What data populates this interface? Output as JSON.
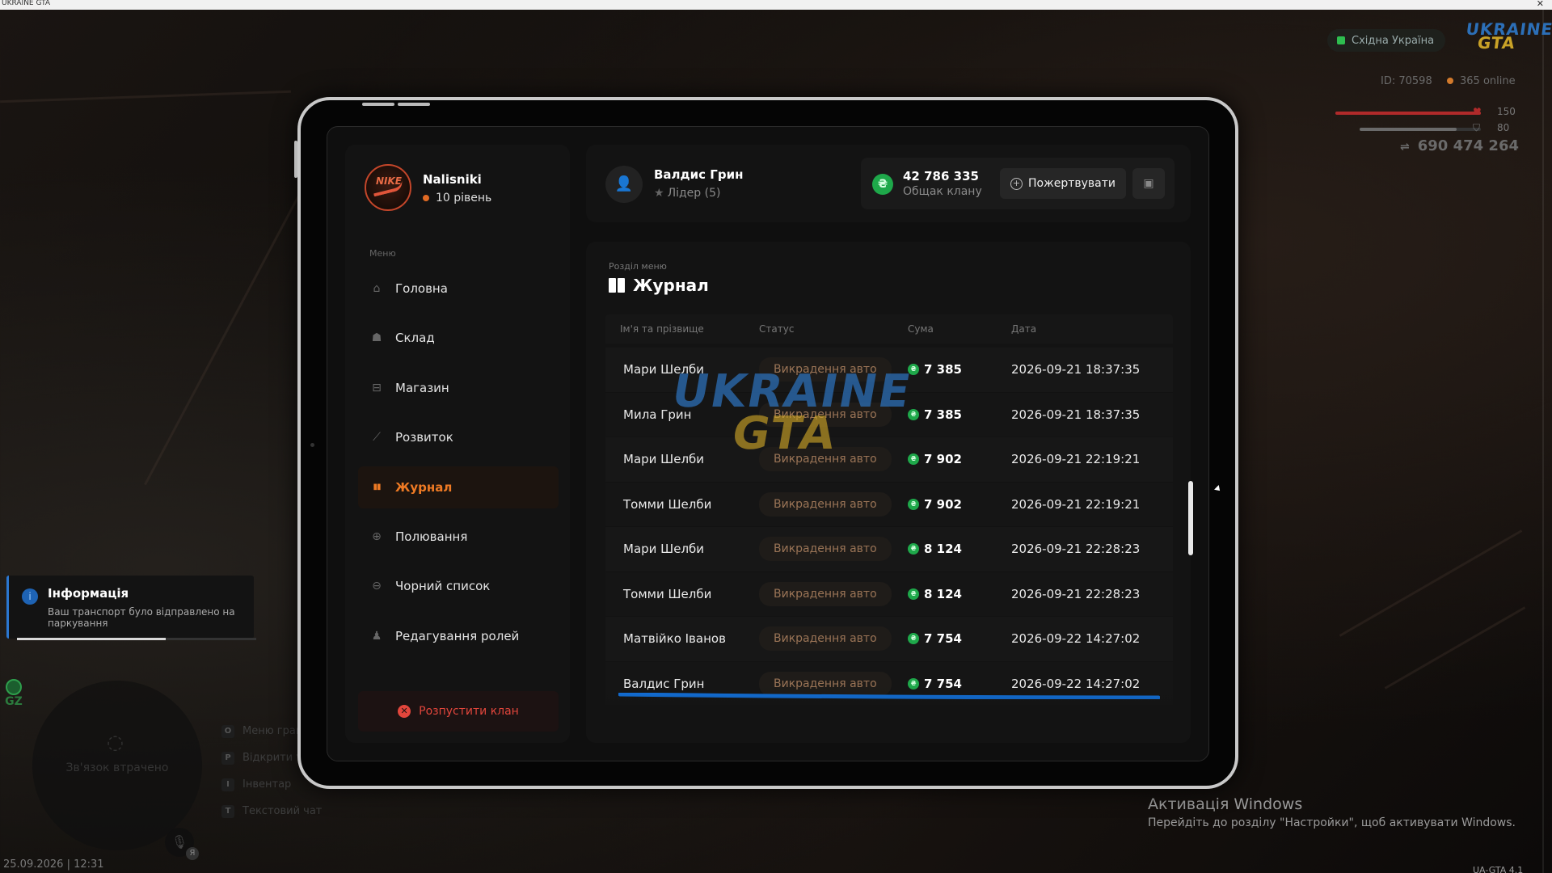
{
  "window": {
    "title": "UKRAINE GTA",
    "close_glyph": "✕"
  },
  "hud": {
    "server_name": "Східна Україна",
    "server_status_color": "#2ebd4f",
    "logo": {
      "line1": "UKRAINE",
      "line2": "GTA"
    },
    "id_text": "ID: 70598",
    "online_text": "365 online",
    "health_value": "150",
    "health_fraction": 1.0,
    "armor_value": "80",
    "armor_fraction": 0.8,
    "money": "690 474 264"
  },
  "notification": {
    "title": "Інформація",
    "text": "Ваш транспорт було відправлено на паркування",
    "progress_fraction": 0.62,
    "accent": "#2b77d0"
  },
  "gz_label": "GZ",
  "radar": {
    "status": "Зв'язок втрачено",
    "icon": "wifi-off-icon"
  },
  "mic": {
    "key": "Я",
    "icon": "microphone-icon"
  },
  "keybinds": [
    {
      "key": "O",
      "label": "Меню гравця"
    },
    {
      "key": "P",
      "label": "Відкрити телефон"
    },
    {
      "key": "I",
      "label": "Інвентар"
    },
    {
      "key": "T",
      "label": "Текстовий чат"
    }
  ],
  "datetime": "25.09.2026 | 12:31",
  "windows_activation": {
    "title": "Активація Windows",
    "text": "Перейдіть до розділу \"Настройки\", щоб активувати Windows."
  },
  "version": "UA-GTA 4.1",
  "profile": {
    "name": "Nalisniki",
    "level": "10 рівень",
    "level_dot_color": "#e06a24",
    "avatar_text": "NIKE"
  },
  "menu": {
    "label": "Меню",
    "items": [
      {
        "label": "Головна",
        "icon": "home-icon",
        "glyph": "⌂",
        "active": false
      },
      {
        "label": "Склад",
        "icon": "people-icon",
        "glyph": "☗",
        "active": false
      },
      {
        "label": "Магазин",
        "icon": "basket-icon",
        "glyph": "⊟",
        "active": false
      },
      {
        "label": "Розвиток",
        "icon": "chart-icon",
        "glyph": "⟋",
        "active": false
      },
      {
        "label": "Журнал",
        "icon": "book-icon",
        "glyph": "▮▮",
        "active": true
      },
      {
        "label": "Полювання",
        "icon": "crosshair-icon",
        "glyph": "⊕",
        "active": false
      },
      {
        "label": "Чорний список",
        "icon": "block-icon",
        "glyph": "⊖",
        "active": false
      },
      {
        "label": "Редагування ролей",
        "icon": "user-edit-icon",
        "glyph": "♟",
        "active": false
      }
    ],
    "disband_label": "Розпустити клан"
  },
  "header": {
    "user_name": "Валдис Грин",
    "user_role": "Лідер (5)",
    "bank_amount": "42 786 335",
    "bank_label": "Общак клану",
    "donate_label": "Пожертвувати",
    "accent_color": "#ee7a24"
  },
  "journal": {
    "section_label": "Розділ меню",
    "title": "Журнал",
    "columns": [
      "Ім'я та прізвище",
      "Статус",
      "Сума",
      "Дата"
    ],
    "watermark": {
      "line1": "UKRAINE",
      "line2": "GTA"
    },
    "rows": [
      {
        "name": "Мари Шелби",
        "status": "Викрадення авто",
        "amount": "7 385",
        "date": "2026-09-21 18:37:35"
      },
      {
        "name": "Мила Грин",
        "status": "Викрадення авто",
        "amount": "7 385",
        "date": "2026-09-21 18:37:35"
      },
      {
        "name": "Мари Шелби",
        "status": "Викрадення авто",
        "amount": "7 902",
        "date": "2026-09-21 22:19:21"
      },
      {
        "name": "Томми Шелби",
        "status": "Викрадення авто",
        "amount": "7 902",
        "date": "2026-09-21 22:19:21"
      },
      {
        "name": "Мари Шелби",
        "status": "Викрадення авто",
        "amount": "8 124",
        "date": "2026-09-21 22:28:23"
      },
      {
        "name": "Томми Шелби",
        "status": "Викрадення авто",
        "amount": "8 124",
        "date": "2026-09-21 22:28:23"
      },
      {
        "name": "Матвійко Іванов",
        "status": "Викрадення авто",
        "amount": "7 754",
        "date": "2026-09-22 14:27:02"
      },
      {
        "name": "Валдис Грин",
        "status": "Викрадення авто",
        "amount": "7 754",
        "date": "2026-09-22 14:27:02"
      }
    ]
  }
}
